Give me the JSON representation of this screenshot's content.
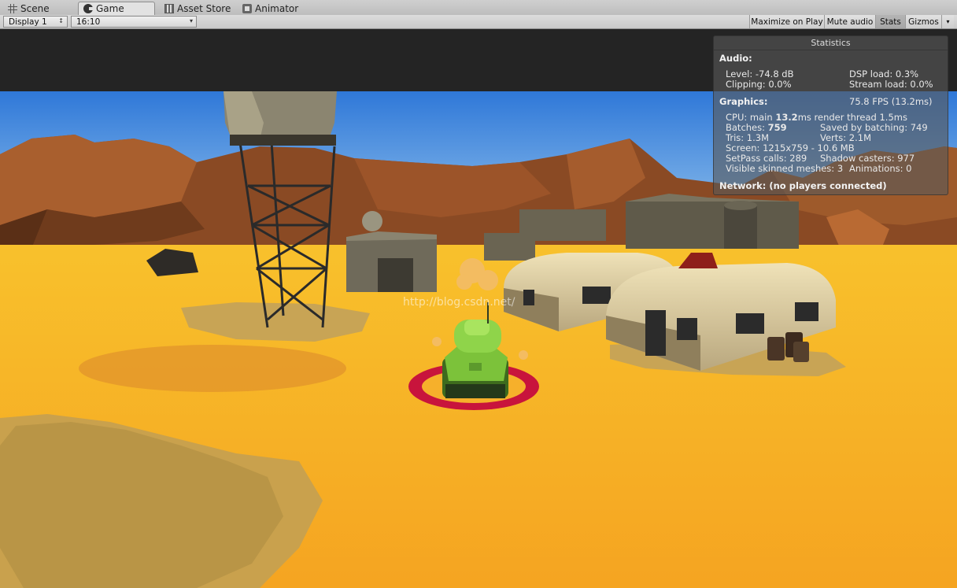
{
  "tabs": [
    {
      "label": "Scene",
      "icon": "grid-icon",
      "active": false
    },
    {
      "label": "Game",
      "icon": "pacman-icon",
      "active": true
    },
    {
      "label": "Asset Store",
      "icon": "store-icon",
      "active": false
    },
    {
      "label": "Animator",
      "icon": "animator-icon",
      "active": false
    }
  ],
  "toolbar": {
    "display": "Display 1",
    "aspect": "16:10",
    "maximize_on_play": "Maximize on Play",
    "mute_audio": "Mute audio",
    "stats": "Stats",
    "gizmos": "Gizmos"
  },
  "stats": {
    "title": "Statistics",
    "audio_header": "Audio:",
    "level": "Level: -74.8 dB",
    "dsp_load": "DSP load: 0.3%",
    "clipping": "Clipping: 0.0%",
    "stream_load": "Stream load: 0.0%",
    "graphics_header": "Graphics:",
    "fps": "75.8 FPS (13.2ms)",
    "cpu_prefix": "CPU: main ",
    "cpu_main": "13.2",
    "cpu_suffix": "ms  render thread 1.5ms",
    "batches_prefix": "Batches: ",
    "batches": "759",
    "saved_by_batching": "Saved by batching: 749",
    "tris": "Tris: 1.3M",
    "verts": "Verts: 2.1M",
    "screen": "Screen: 1215x759 - 10.6 MB",
    "setpass": "SetPass calls: 289",
    "shadow_casters": "Shadow casters: 977",
    "skinned_meshes": "Visible skinned meshes: 3",
    "animations": "Animations: 0",
    "network": "Network: (no players connected)"
  },
  "watermark": "http://blog.csdn.net/",
  "colors": {
    "sky_top": "#2f78d8",
    "sky_bottom": "#a9d3f1",
    "ground": "#f7b226",
    "cliffs": "#8a4a24",
    "tank": "#7cc23a",
    "target_ring": "#c8143c",
    "overlay_bg": "#585858"
  }
}
